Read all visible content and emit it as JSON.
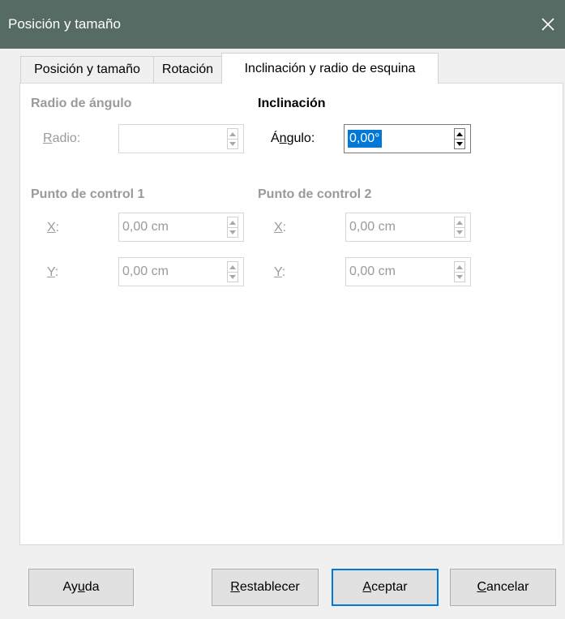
{
  "window": {
    "title": "Posición y tamaño"
  },
  "tabs": [
    {
      "label": "Posición y tamaño",
      "active": false
    },
    {
      "label": "Rotación",
      "active": false
    },
    {
      "label": "Inclinación y radio de esquina",
      "active": true
    }
  ],
  "corner_radius": {
    "heading": "Radio de ángulo",
    "radius_label_u": "R",
    "radius_label_rest": "adio:",
    "radius_value": ""
  },
  "slant": {
    "heading": "Inclinación",
    "angle_label_pre": "Á",
    "angle_label_u": "n",
    "angle_label_rest": "gulo:",
    "angle_value": "0,00°"
  },
  "control_point_1": {
    "heading": "Punto de control 1",
    "x_label_u": "X",
    "x_label_rest": ":",
    "x_value": "0,00 cm",
    "y_label_u": "Y",
    "y_label_rest": ":",
    "y_value": "0,00 cm"
  },
  "control_point_2": {
    "heading": "Punto de control 2",
    "x_label_u": "X",
    "x_label_rest": ":",
    "x_value": "0,00 cm",
    "y_label_u": "Y",
    "y_label_rest": ":",
    "y_value": "0,00 cm"
  },
  "buttons": {
    "help_pre": "Ay",
    "help_u": "u",
    "help_rest": "da",
    "reset_u": "R",
    "reset_rest": "establecer",
    "ok_u": "A",
    "ok_rest": "ceptar",
    "cancel_u": "C",
    "cancel_rest": "ancelar"
  },
  "colors": {
    "titlebar": "#556b63",
    "accent": "#0078d7",
    "disabled_text": "#9a9a9a"
  }
}
